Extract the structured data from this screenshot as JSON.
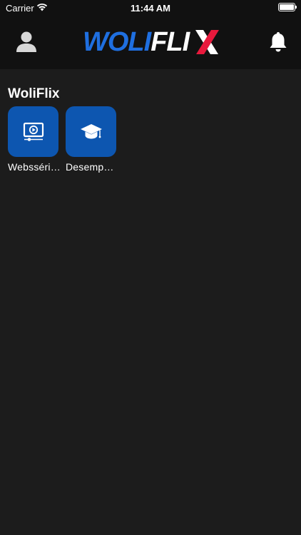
{
  "status_bar": {
    "carrier": "Carrier",
    "time": "11:44 AM",
    "battery_level": 1.0
  },
  "nav": {
    "logo_primary": "WOLI",
    "logo_secondary": "FLI",
    "profile_icon": "person-icon",
    "notifications_icon": "bell-icon"
  },
  "section": {
    "title": "WoliFlix"
  },
  "apps": [
    {
      "label": "Websséri…",
      "icon": "video-player-icon"
    },
    {
      "label": "Desemp…",
      "icon": "graduation-cap-icon"
    }
  ],
  "colors": {
    "background": "#1c1c1c",
    "header": "#111111",
    "tile": "#0d56b0",
    "logo_blue": "#1f6fe0",
    "logo_red": "#e8193c"
  }
}
